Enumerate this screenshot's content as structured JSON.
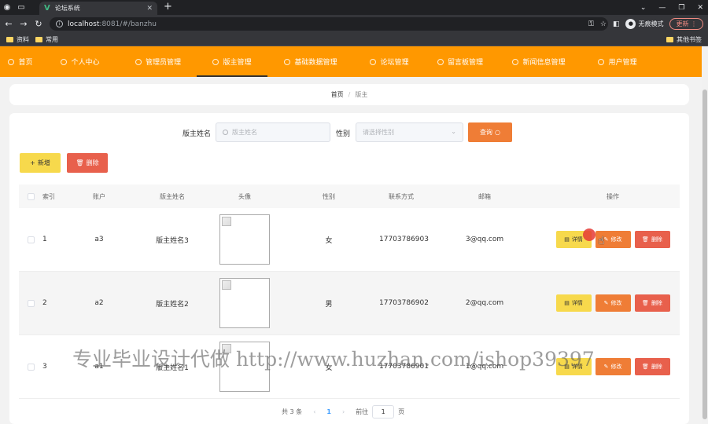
{
  "browser": {
    "tab_title": "论坛系统",
    "url_host": "localhost",
    "url_path": ":8081/#/banzhu",
    "incognito_label": "无痕模式",
    "update_label": "更新",
    "bookmarks": [
      "资料",
      "常用"
    ],
    "other_bookmarks": "其他书签"
  },
  "nav": {
    "items": [
      {
        "label": "首页"
      },
      {
        "label": "个人中心"
      },
      {
        "label": "管理员管理"
      },
      {
        "label": "版主管理"
      },
      {
        "label": "基础数据管理"
      },
      {
        "label": "论坛管理"
      },
      {
        "label": "留言板管理"
      },
      {
        "label": "新闻信息管理"
      },
      {
        "label": "用户管理"
      }
    ],
    "active": "版主管理"
  },
  "breadcrumb": {
    "home": "首页",
    "separator": "/",
    "current": "版主"
  },
  "search": {
    "name_label": "版主姓名",
    "name_placeholder": "版主姓名",
    "gender_label": "性别",
    "gender_placeholder": "请选择性别",
    "query_label": "查询"
  },
  "actions": {
    "add_label": "新增",
    "delete_label": "删除"
  },
  "table": {
    "headers": {
      "index": "索引",
      "account": "账户",
      "name": "版主姓名",
      "avatar": "头像",
      "gender": "性别",
      "phone": "联系方式",
      "email": "邮箱",
      "ops": "操作"
    },
    "rows": [
      {
        "index": "1",
        "account": "a3",
        "name": "版主姓名3",
        "gender": "女",
        "phone": "17703786903",
        "email": "3@qq.com"
      },
      {
        "index": "2",
        "account": "a2",
        "name": "版主姓名2",
        "gender": "男",
        "phone": "17703786902",
        "email": "2@qq.com"
      },
      {
        "index": "3",
        "account": "a1",
        "name": "版主姓名1",
        "gender": "女",
        "phone": "17703786901",
        "email": "1@qq.com"
      }
    ],
    "row_actions": {
      "detail": "详情",
      "edit": "修改",
      "delete": "删除"
    }
  },
  "pager": {
    "total": "共 3 条",
    "current_page": "1",
    "goto_label": "前往",
    "goto_value": "1",
    "page_unit": "页"
  },
  "watermark": "专业毕业设计代做 http://www.huzhan.com/ishop39397",
  "colors": {
    "nav": "#ff9800",
    "query": "#ef7d36",
    "add": "#f7d94c",
    "delete": "#e8604c"
  }
}
